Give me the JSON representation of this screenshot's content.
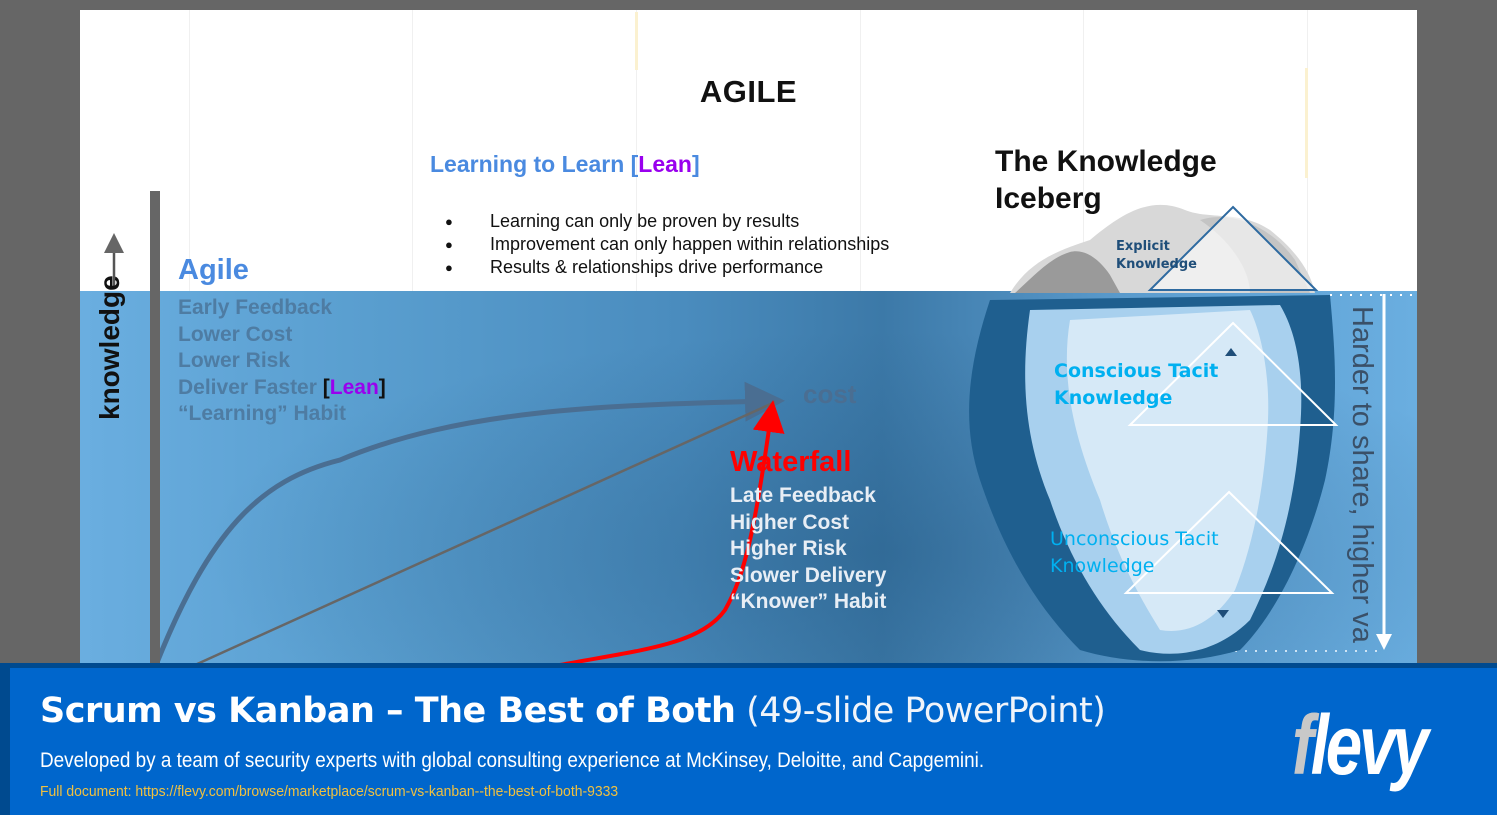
{
  "slide": {
    "title": "AGILE",
    "learning": {
      "heading_prefix": "Learning to Learn [",
      "heading_lean": "Lean",
      "heading_suffix": "]",
      "bullets": [
        "Learning can only be proven by results",
        "Improvement can only happen within relationships",
        "Results & relationships drive performance"
      ]
    },
    "axis_label": "knowledge",
    "cost_label": "cost",
    "agile": {
      "heading": "Agile",
      "items": [
        "Early Feedback",
        "Lower Cost",
        "Lower Risk",
        "Deliver Faster",
        "“Learning” Habit"
      ],
      "lean_tag_open": "[",
      "lean_tag": "Lean",
      "lean_tag_close": "]"
    },
    "waterfall": {
      "heading": "Waterfall",
      "items": [
        "Late Feedback",
        "Higher Cost",
        "Higher Risk",
        "Slower Delivery",
        "“Knower” Habit"
      ]
    },
    "iceberg": {
      "title_line1": "The Knowledge",
      "title_line2": "Iceberg",
      "explicit_line1": "Explicit",
      "explicit_line2": "Knowledge",
      "conscious_line1": "Conscious Tacit",
      "conscious_line2": "Knowledge",
      "unconscious_line1": "Unconscious Tacit",
      "unconscious_line2": "Knowledge",
      "side_label": "Harder to share, higher va"
    },
    "colors": {
      "agile_blue": "#4a8ae0",
      "lean_purple": "#9900ee",
      "waterfall_red": "#ff0000",
      "tacit_cyan": "#00b0f0"
    }
  },
  "footer": {
    "title_bold": "Scrum vs Kanban – The Best of Both",
    "title_light": " (49-slide PowerPoint)",
    "subtitle": "Developed by a team of security experts with global consulting experience at McKinsey, Deloitte, and Capgemini.",
    "link": "Full document: https://flevy.com/browse/marketplace/scrum-vs-kanban--the-best-of-both-9333",
    "logo_first": "f",
    "logo_rest": "levy",
    "bg_color": "#0066cc"
  }
}
